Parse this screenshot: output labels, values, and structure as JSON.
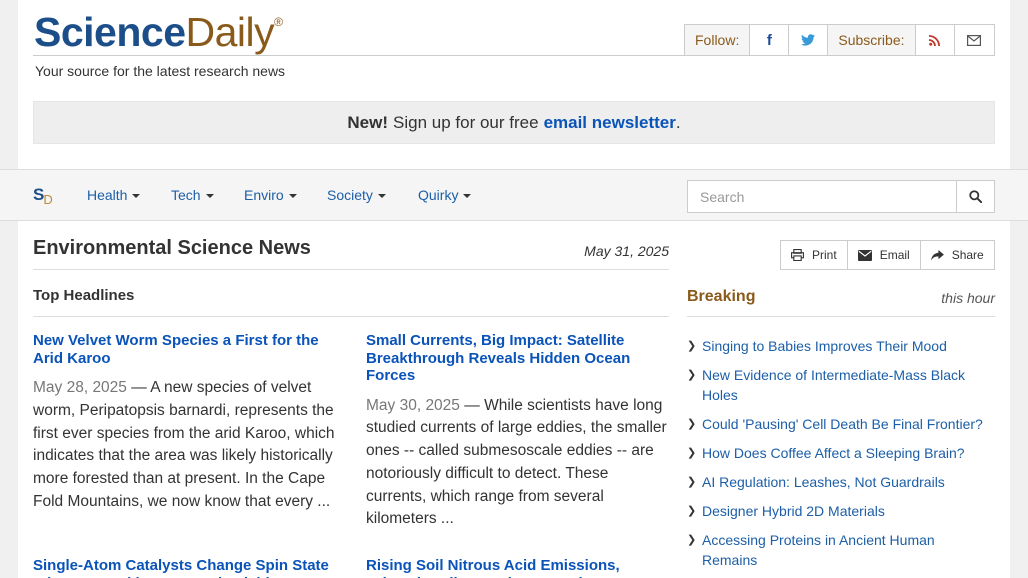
{
  "header": {
    "logo_science": "Science",
    "logo_daily": "Daily",
    "logo_reg": "®",
    "tagline": "Your source for the latest research news",
    "follow_label": "Follow:",
    "subscribe_label": "Subscribe:"
  },
  "newsletter": {
    "new_label": "New!",
    "text": "Sign up for our free",
    "link": "email newsletter",
    "period": "."
  },
  "nav": {
    "logo_s": "S",
    "logo_d": "D",
    "items": [
      {
        "label": "Health"
      },
      {
        "label": "Tech"
      },
      {
        "label": "Enviro"
      },
      {
        "label": "Society"
      },
      {
        "label": "Quirky"
      }
    ],
    "search_placeholder": "Search"
  },
  "main": {
    "section_title": "Environmental Science News",
    "date": "May 31, 2025",
    "top_headlines_label": "Top Headlines",
    "stories": [
      {
        "title": "New Velvet Worm Species a First for the Arid Karoo",
        "date": "May 28, 2025",
        "separator": " — ",
        "summary": "A new species of velvet worm, Peripatopsis barnardi, represents the first ever species from the arid Karoo, which indicates that the area was likely historically more forested than at present. In the Cape Fold Mountains, we now know that every ..."
      },
      {
        "title": "Small Currents, Big Impact: Satellite Breakthrough Reveals Hidden Ocean Forces",
        "date": "May 30, 2025",
        "separator": " — ",
        "summary": "While scientists have long studied currents of large eddies, the smaller ones -- called submesoscale eddies -- are notoriously difficult to detect. These currents, which range from several kilometers ..."
      },
      {
        "title": "Single-Atom Catalysts Change Spin State When Treated in a Magnetic Field"
      },
      {
        "title": "Rising Soil Nitrous Acid Emissions, Driven by Climate Change and"
      }
    ]
  },
  "sidebar": {
    "print_label": "Print",
    "email_label": "Email",
    "share_label": "Share",
    "breaking_label": "Breaking",
    "this_hour_label": "this hour",
    "breaking_items": [
      {
        "label": "Singing to Babies Improves Their Mood"
      },
      {
        "label": "New Evidence of Intermediate-Mass Black Holes"
      },
      {
        "label": "Could 'Pausing' Cell Death Be Final Frontier?"
      },
      {
        "label": "How Does Coffee Affect a Sleeping Brain?"
      },
      {
        "label": "AI Regulation: Leashes, Not Guardrails"
      },
      {
        "label": "Designer Hybrid 2D Materials"
      },
      {
        "label": "Accessing Proteins in Ancient Human Remains"
      }
    ]
  },
  "colors": {
    "link": "#0a53b8",
    "brand_blue": "#1c4f8a",
    "brand_brown": "#8a5a1a"
  }
}
